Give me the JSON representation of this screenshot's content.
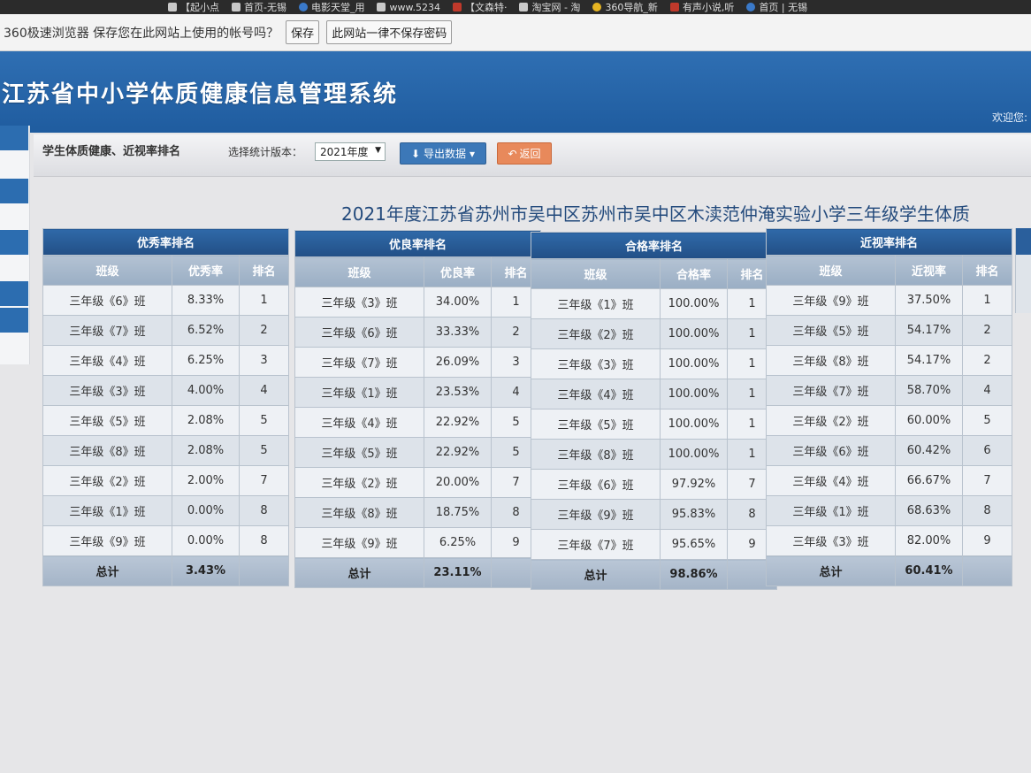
{
  "bookmarks": [
    {
      "label": "【起小点",
      "icon": "page-icon"
    },
    {
      "label": "首页-无锡",
      "icon": "page-icon"
    },
    {
      "label": "电影天堂_用",
      "icon": "globe-icon"
    },
    {
      "label": "www.5234",
      "icon": "page-icon"
    },
    {
      "label": "【文森特·",
      "icon": "flag-icon"
    },
    {
      "label": "淘宝网 - 淘",
      "icon": "page-icon"
    },
    {
      "label": "360导航_新",
      "icon": "star-icon"
    },
    {
      "label": "有声小说,听",
      "icon": "listen-icon"
    },
    {
      "label": "首页 | 无锡",
      "icon": "cloud-icon"
    }
  ],
  "password_prompt": {
    "message": "360极速浏览器 保存您在此网站上使用的帐号吗？",
    "save_label": "保存",
    "never_label": "此网站一律不保存密码"
  },
  "header": {
    "title": "江苏省中小学体质健康信息管理系统",
    "welcome": "欢迎您: "
  },
  "toolbar": {
    "title": "学生体质健康、近视率排名",
    "version_label": "选择统计版本：",
    "version_value": "2021年度",
    "export_label": "导出数据",
    "back_label": "返回"
  },
  "report_title": "2021年度江苏省苏州市吴中区苏州市吴中区木渎范仲淹实验小学三年级学生体质",
  "tables": [
    {
      "caption": "优秀率排名",
      "headers": [
        "班级",
        "优秀率",
        "排名"
      ],
      "rows": [
        [
          "三年级《6》班",
          "8.33%",
          "1"
        ],
        [
          "三年级《7》班",
          "6.52%",
          "2"
        ],
        [
          "三年级《4》班",
          "6.25%",
          "3"
        ],
        [
          "三年级《3》班",
          "4.00%",
          "4"
        ],
        [
          "三年级《5》班",
          "2.08%",
          "5"
        ],
        [
          "三年级《8》班",
          "2.08%",
          "5"
        ],
        [
          "三年级《2》班",
          "2.00%",
          "7"
        ],
        [
          "三年级《1》班",
          "0.00%",
          "8"
        ],
        [
          "三年级《9》班",
          "0.00%",
          "8"
        ]
      ],
      "total_label": "总计",
      "total_value": "3.43%"
    },
    {
      "caption": "优良率排名",
      "headers": [
        "班级",
        "优良率",
        "排名"
      ],
      "rows": [
        [
          "三年级《3》班",
          "34.00%",
          "1"
        ],
        [
          "三年级《6》班",
          "33.33%",
          "2"
        ],
        [
          "三年级《7》班",
          "26.09%",
          "3"
        ],
        [
          "三年级《1》班",
          "23.53%",
          "4"
        ],
        [
          "三年级《4》班",
          "22.92%",
          "5"
        ],
        [
          "三年级《5》班",
          "22.92%",
          "5"
        ],
        [
          "三年级《2》班",
          "20.00%",
          "7"
        ],
        [
          "三年级《8》班",
          "18.75%",
          "8"
        ],
        [
          "三年级《9》班",
          "6.25%",
          "9"
        ]
      ],
      "total_label": "总计",
      "total_value": "23.11%"
    },
    {
      "caption": "合格率排名",
      "headers": [
        "班级",
        "合格率",
        "排名"
      ],
      "rows": [
        [
          "三年级《1》班",
          "100.00%",
          "1"
        ],
        [
          "三年级《2》班",
          "100.00%",
          "1"
        ],
        [
          "三年级《3》班",
          "100.00%",
          "1"
        ],
        [
          "三年级《4》班",
          "100.00%",
          "1"
        ],
        [
          "三年级《5》班",
          "100.00%",
          "1"
        ],
        [
          "三年级《8》班",
          "100.00%",
          "1"
        ],
        [
          "三年级《6》班",
          "97.92%",
          "7"
        ],
        [
          "三年级《9》班",
          "95.83%",
          "8"
        ],
        [
          "三年级《7》班",
          "95.65%",
          "9"
        ]
      ],
      "total_label": "总计",
      "total_value": "98.86%"
    },
    {
      "caption": "近视率排名",
      "headers": [
        "班级",
        "近视率",
        "排名"
      ],
      "rows": [
        [
          "三年级《9》班",
          "37.50%",
          "1"
        ],
        [
          "三年级《5》班",
          "54.17%",
          "2"
        ],
        [
          "三年级《8》班",
          "54.17%",
          "2"
        ],
        [
          "三年级《7》班",
          "58.70%",
          "4"
        ],
        [
          "三年级《2》班",
          "60.00%",
          "5"
        ],
        [
          "三年级《6》班",
          "60.42%",
          "6"
        ],
        [
          "三年级《4》班",
          "66.67%",
          "7"
        ],
        [
          "三年级《1》班",
          "68.63%",
          "8"
        ],
        [
          "三年级《3》班",
          "82.00%",
          "9"
        ]
      ],
      "total_label": "总计",
      "total_value": "60.41%"
    }
  ],
  "colors": {
    "header_blue": "#2f6fb3",
    "table_caption": "#2a5f9c",
    "export_button": "#3c78b8",
    "back_button": "#e8895b"
  }
}
